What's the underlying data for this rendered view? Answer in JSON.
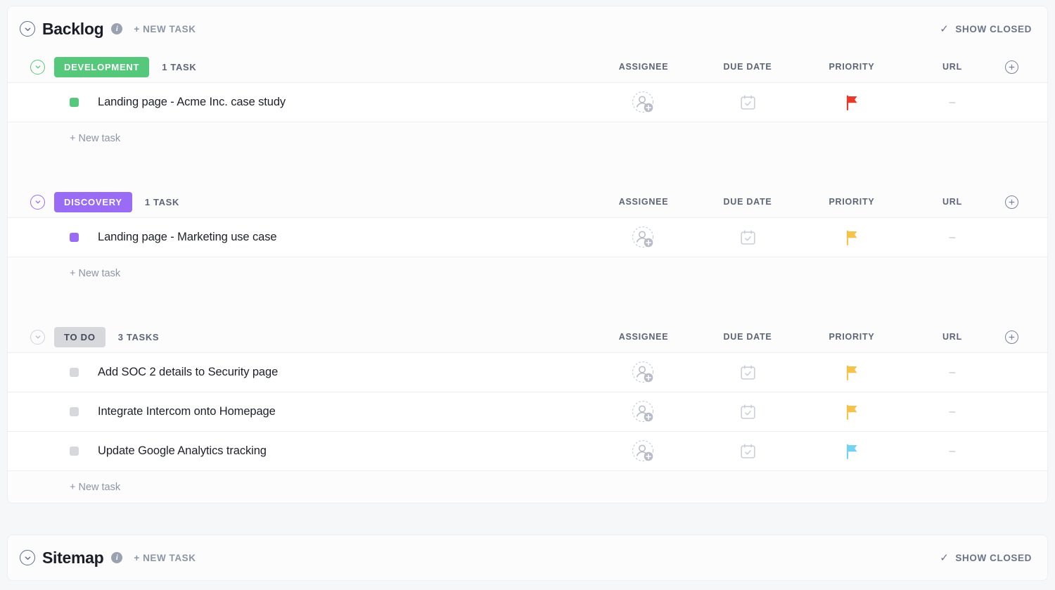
{
  "theme": {
    "page_bg": "#f6f7f9",
    "card_bg": "#fcfcfd",
    "row_bg": "#ffffff",
    "green": "#56c87b",
    "purple": "#9a6bf5",
    "gray_pill": "#d6d8dc",
    "flag_red": "#e8392b",
    "flag_yellow": "#f5c24a",
    "flag_blue": "#74d2f2",
    "text_dark": "#1d2029",
    "text_muted": "#5d6577"
  },
  "lists": [
    {
      "title": "Backlog",
      "info_icon": "info-icon",
      "new_task_label": "+ NEW TASK",
      "show_closed_label": "SHOW CLOSED",
      "show_closed_icon": "check-icon",
      "collapse_icon": "chevron-down-icon",
      "columns": {
        "assignee": "ASSIGNEE",
        "due_date": "DUE DATE",
        "priority": "PRIORITY",
        "url": "URL",
        "add_column_icon": "plus-circle-icon"
      },
      "new_task_row_label": "+ New task",
      "groups": [
        {
          "status": "DEVELOPMENT",
          "color": "green",
          "count_label": "1 TASK",
          "chevron_icon": "chevron-down-icon",
          "tasks": [
            {
              "title": "Landing page - Acme Inc. case study",
              "status_color": "green",
              "assignee": "",
              "assignee_icon": "add-assignee-icon",
              "due_date": "",
              "due_date_icon": "calendar-icon",
              "priority": "urgent",
              "priority_icon": "flag-icon",
              "priority_color": "#e8392b",
              "url": "–"
            }
          ]
        },
        {
          "status": "DISCOVERY",
          "color": "purple",
          "count_label": "1 TASK",
          "chevron_icon": "chevron-down-icon",
          "tasks": [
            {
              "title": "Landing page - Marketing use case",
              "status_color": "purple",
              "assignee": "",
              "assignee_icon": "add-assignee-icon",
              "due_date": "",
              "due_date_icon": "calendar-icon",
              "priority": "high",
              "priority_icon": "flag-icon",
              "priority_color": "#f5c24a",
              "url": "–"
            }
          ]
        },
        {
          "status": "TO DO",
          "color": "gray",
          "count_label": "3 TASKS",
          "chevron_icon": "chevron-down-icon",
          "tasks": [
            {
              "title": "Add SOC 2 details to Security page",
              "status_color": "gray",
              "assignee": "",
              "assignee_icon": "add-assignee-icon",
              "due_date": "",
              "due_date_icon": "calendar-icon",
              "priority": "high",
              "priority_icon": "flag-icon",
              "priority_color": "#f5c24a",
              "url": "–"
            },
            {
              "title": "Integrate Intercom onto Homepage",
              "status_color": "gray",
              "assignee": "",
              "assignee_icon": "add-assignee-icon",
              "due_date": "",
              "due_date_icon": "calendar-icon",
              "priority": "high",
              "priority_icon": "flag-icon",
              "priority_color": "#f5c24a",
              "url": "–"
            },
            {
              "title": "Update Google Analytics tracking",
              "status_color": "gray",
              "assignee": "",
              "assignee_icon": "add-assignee-icon",
              "due_date": "",
              "due_date_icon": "calendar-icon",
              "priority": "low",
              "priority_icon": "flag-icon",
              "priority_color": "#74d2f2",
              "url": "–"
            }
          ]
        }
      ]
    },
    {
      "title": "Sitemap",
      "info_icon": "info-icon",
      "new_task_label": "+ NEW TASK",
      "show_closed_label": "SHOW CLOSED",
      "show_closed_icon": "check-icon",
      "collapse_icon": "chevron-down-icon",
      "groups": []
    }
  ]
}
